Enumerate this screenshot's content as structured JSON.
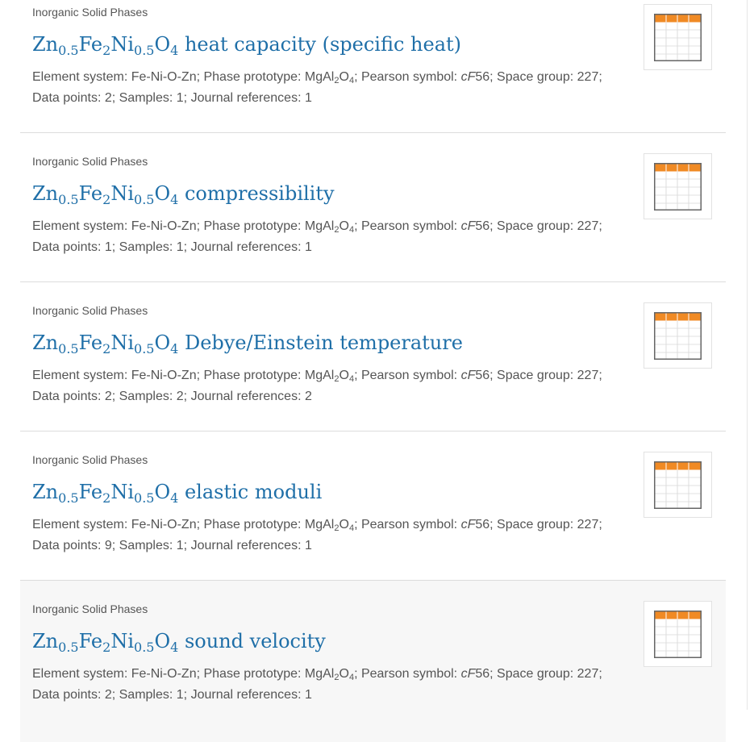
{
  "accent_color": "#1f6fa8",
  "table_icon_color": "#f08a24",
  "entries": [
    {
      "category": "Inorganic Solid Phases",
      "compound": {
        "zn": "Zn",
        "zn_sub": "0.5",
        "fe": "Fe",
        "fe_sub": "2",
        "ni": "Ni",
        "ni_sub": "0.5",
        "o": "O",
        "o_sub": "4"
      },
      "property": " heat capacity (specific heat)",
      "meta": {
        "element_system_label": "Element system: ",
        "element_system": "Fe-Ni-O-Zn",
        "prototype_label": "; Phase prototype: ",
        "prototype_a": "MgAl",
        "prototype_a_sub": "2",
        "prototype_b": "O",
        "prototype_b_sub": "4",
        "pearson_label": "; Pearson symbol: ",
        "pearson_italic": "cF",
        "pearson_num": "56",
        "space_group_label": "; Space group: ",
        "space_group": "227;",
        "data_points_label": "Data points: ",
        "data_points": "2",
        "samples_label": "; Samples: ",
        "samples": "1",
        "journal_label": "; Journal references: ",
        "journal": "1"
      },
      "icon": "table-icon"
    },
    {
      "category": "Inorganic Solid Phases",
      "compound": {
        "zn": "Zn",
        "zn_sub": "0.5",
        "fe": "Fe",
        "fe_sub": "2",
        "ni": "Ni",
        "ni_sub": "0.5",
        "o": "O",
        "o_sub": "4"
      },
      "property": " compressibility",
      "meta": {
        "element_system_label": "Element system: ",
        "element_system": "Fe-Ni-O-Zn",
        "prototype_label": "; Phase prototype: ",
        "prototype_a": "MgAl",
        "prototype_a_sub": "2",
        "prototype_b": "O",
        "prototype_b_sub": "4",
        "pearson_label": "; Pearson symbol: ",
        "pearson_italic": "cF",
        "pearson_num": "56",
        "space_group_label": "; Space group: ",
        "space_group": "227;",
        "data_points_label": "Data points: ",
        "data_points": "1",
        "samples_label": "; Samples: ",
        "samples": "1",
        "journal_label": "; Journal references: ",
        "journal": "1"
      },
      "icon": "table-icon"
    },
    {
      "category": "Inorganic Solid Phases",
      "compound": {
        "zn": "Zn",
        "zn_sub": "0.5",
        "fe": "Fe",
        "fe_sub": "2",
        "ni": "Ni",
        "ni_sub": "0.5",
        "o": "O",
        "o_sub": "4"
      },
      "property": " Debye/Einstein temperature",
      "meta": {
        "element_system_label": "Element system: ",
        "element_system": "Fe-Ni-O-Zn",
        "prototype_label": "; Phase prototype: ",
        "prototype_a": "MgAl",
        "prototype_a_sub": "2",
        "prototype_b": "O",
        "prototype_b_sub": "4",
        "pearson_label": "; Pearson symbol: ",
        "pearson_italic": "cF",
        "pearson_num": "56",
        "space_group_label": "; Space group: ",
        "space_group": "227;",
        "data_points_label": "Data points: ",
        "data_points": "2",
        "samples_label": "; Samples: ",
        "samples": "2",
        "journal_label": "; Journal references: ",
        "journal": "2"
      },
      "icon": "table-icon"
    },
    {
      "category": "Inorganic Solid Phases",
      "compound": {
        "zn": "Zn",
        "zn_sub": "0.5",
        "fe": "Fe",
        "fe_sub": "2",
        "ni": "Ni",
        "ni_sub": "0.5",
        "o": "O",
        "o_sub": "4"
      },
      "property": " elastic moduli",
      "meta": {
        "element_system_label": "Element system: ",
        "element_system": "Fe-Ni-O-Zn",
        "prototype_label": "; Phase prototype: ",
        "prototype_a": "MgAl",
        "prototype_a_sub": "2",
        "prototype_b": "O",
        "prototype_b_sub": "4",
        "pearson_label": "; Pearson symbol: ",
        "pearson_italic": "cF",
        "pearson_num": "56",
        "space_group_label": "; Space group: ",
        "space_group": "227;",
        "data_points_label": "Data points: ",
        "data_points": "9",
        "samples_label": "; Samples: ",
        "samples": "1",
        "journal_label": "; Journal references: ",
        "journal": "1"
      },
      "icon": "table-icon"
    },
    {
      "category": "Inorganic Solid Phases",
      "compound": {
        "zn": "Zn",
        "zn_sub": "0.5",
        "fe": "Fe",
        "fe_sub": "2",
        "ni": "Ni",
        "ni_sub": "0.5",
        "o": "O",
        "o_sub": "4"
      },
      "property": " sound velocity",
      "meta": {
        "element_system_label": "Element system: ",
        "element_system": "Fe-Ni-O-Zn",
        "prototype_label": "; Phase prototype: ",
        "prototype_a": "MgAl",
        "prototype_a_sub": "2",
        "prototype_b": "O",
        "prototype_b_sub": "4",
        "pearson_label": "; Pearson symbol: ",
        "pearson_italic": "cF",
        "pearson_num": "56",
        "space_group_label": "; Space group: ",
        "space_group": "227;",
        "data_points_label": "Data points: ",
        "data_points": "2",
        "samples_label": "; Samples: ",
        "samples": "1",
        "journal_label": "; Journal references: ",
        "journal": "1"
      },
      "icon": "table-icon"
    }
  ]
}
